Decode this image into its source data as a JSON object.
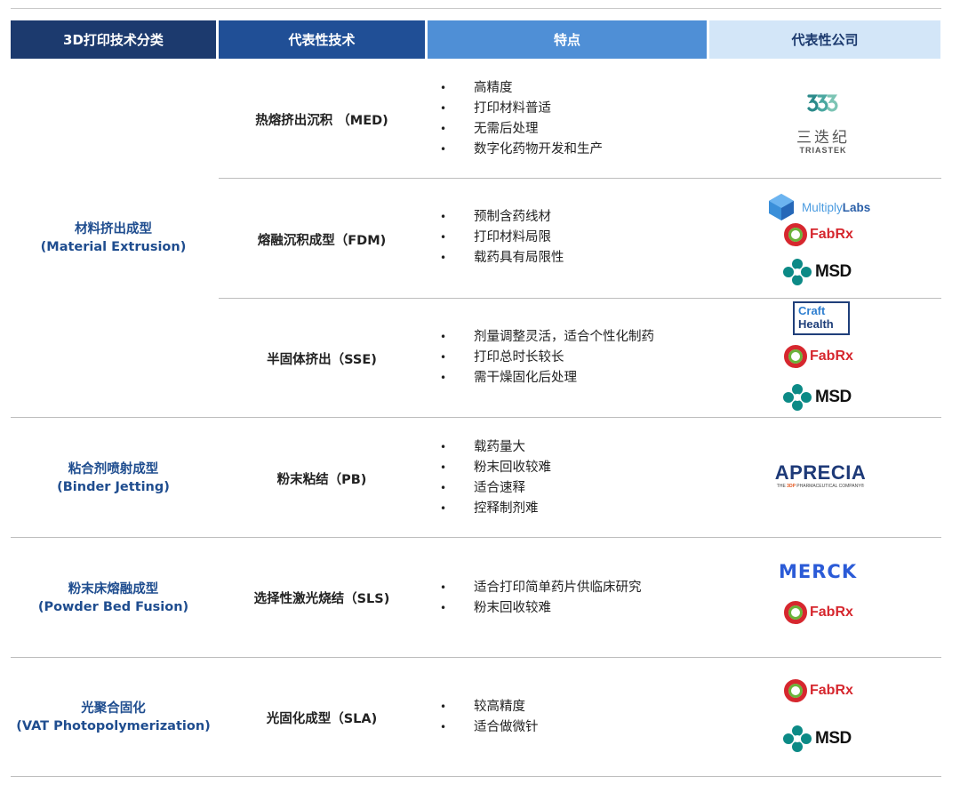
{
  "header": {
    "col1": "3D打印技术分类",
    "col2": "代表性技术",
    "col3": "特点",
    "col4": "代表性公司"
  },
  "categories": [
    {
      "line1": "材料挤出成型",
      "line2": "(Material Extrusion)"
    },
    {
      "line1": "粘合剂喷射成型",
      "line2": "(Binder Jetting)"
    },
    {
      "line1": "粉末床熔融成型",
      "line2": "(Powder Bed Fusion)"
    },
    {
      "line1": "光聚合固化",
      "line2": "(VAT Photopolymerization)"
    }
  ],
  "rows": [
    {
      "tech": "热熔挤出沉积 （MED)",
      "features": [
        "高精度",
        "打印材料普适",
        "无需后处理",
        "数字化药物开发和生产"
      ]
    },
    {
      "tech": "熔融沉积成型（FDM)",
      "features": [
        "预制含药线材",
        "打印材料局限",
        "载药具有局限性"
      ]
    },
    {
      "tech": "半固体挤出（SSE)",
      "features": [
        "剂量调整灵活，适合个性化制药",
        "打印总时长较长",
        "需干燥固化后处理"
      ]
    },
    {
      "tech": "粉末粘结（PB)",
      "features": [
        "载药量大",
        "粉末回收较难",
        "适合速释",
        "控释制剂难"
      ]
    },
    {
      "tech": "选择性激光烧结（SLS)",
      "features": [
        "适合打印简单药片供临床研究",
        "粉末回收较难"
      ]
    },
    {
      "tech": "光固化成型（SLA)",
      "features": [
        "较高精度",
        "适合做微针"
      ]
    }
  ],
  "logos": {
    "triastek_cn": "三迭纪",
    "triastek_en": "TRIASTEK",
    "multiply_a": "Multiply",
    "multiply_b": "Labs",
    "fabrx": "FabRx",
    "msd": "MSD",
    "craft_1": "Craft",
    "craft_2": "Health",
    "aprecia": "APRECIA",
    "aprecia_tag_a": "THE ",
    "aprecia_tag_b": "3DP",
    "aprecia_tag_c": " PHARMACEUTICAL COMPANY®",
    "merck": "MERCK"
  },
  "bullet": "•",
  "colors": {
    "header1": "#1c3a6e",
    "header2": "#204f96",
    "header3": "#4f8fd6",
    "header4": "#d3e6f8",
    "category_text": "#1f4d8f",
    "fabrx_red": "#d6272e",
    "fabrx_green": "#6bb33a",
    "msd_teal": "#0c8a86",
    "merck_blue": "#2b5bd7",
    "triastek_teal": "#2b8a8a"
  }
}
